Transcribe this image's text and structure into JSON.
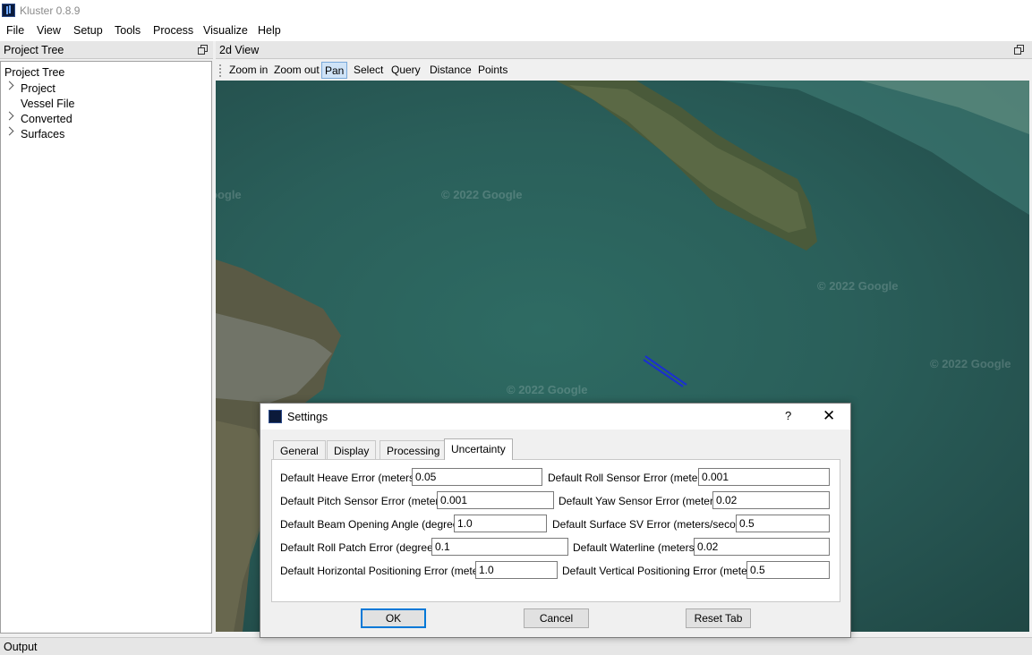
{
  "window": {
    "title": "Kluster 0.8.9"
  },
  "menu": [
    "File",
    "View",
    "Setup",
    "Tools",
    "Process",
    "Visualize",
    "Help"
  ],
  "project_dock": {
    "title": "Project Tree",
    "tree_header": "Project Tree",
    "items": [
      {
        "label": "Project",
        "expandable": true
      },
      {
        "label": "Vessel File",
        "expandable": false
      },
      {
        "label": "Converted",
        "expandable": true
      },
      {
        "label": "Surfaces",
        "expandable": true
      }
    ]
  },
  "view_dock": {
    "title": "2d View",
    "tools": [
      "Zoom in",
      "Zoom out",
      "Pan",
      "Select",
      "Query",
      "Distance",
      "Points"
    ],
    "active_tool": "Pan",
    "watermarks": [
      "© 2022 Google",
      "© 2022 Google",
      "© 2022 Google",
      "© 2022 Google",
      "oogle"
    ]
  },
  "dialog": {
    "title": "Settings",
    "help": "?",
    "close": "✕",
    "tabs": [
      "General",
      "Display",
      "Processing",
      "Uncertainty"
    ],
    "active_tab": "Uncertainty",
    "fields": [
      {
        "label": "Default Heave Error (meters)",
        "value": "0.05"
      },
      {
        "label": "Default Roll Sensor Error (meters)",
        "value": "0.001"
      },
      {
        "label": "Default Pitch Sensor Error (meters)",
        "value": "0.001"
      },
      {
        "label": "Default Yaw Sensor Error (meters)",
        "value": "0.02"
      },
      {
        "label": "Default Beam Opening Angle (degrees)",
        "value": "1.0"
      },
      {
        "label": "Default Surface SV Error (meters/second)",
        "value": "0.5"
      },
      {
        "label": "Default Roll Patch Error (degrees)",
        "value": "0.1"
      },
      {
        "label": "Default Waterline (meters)",
        "value": "0.02"
      },
      {
        "label": "Default Horizontal Positioning Error (meters)",
        "value": "1.0"
      },
      {
        "label": "Default Vertical Positioning Error (meters)",
        "value": "0.5"
      }
    ],
    "buttons": {
      "ok": "OK",
      "cancel": "Cancel",
      "reset": "Reset Tab"
    }
  },
  "output_dock": {
    "title": "Output"
  },
  "colors": {
    "water": "#2a5f5a",
    "track_line": "#1a2fd0",
    "selection": "#cfe3f7",
    "default_button": "#0078d7"
  }
}
